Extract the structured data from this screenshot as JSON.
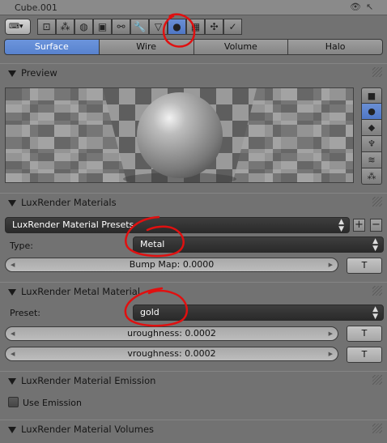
{
  "top_strip": {
    "object_name": "Cube.001"
  },
  "context_tabs": [
    {
      "icon": "render-camera-icon",
      "glyph": "📷"
    },
    {
      "icon": "render-layers-icon",
      "glyph": "◉"
    },
    {
      "icon": "world-icon",
      "glyph": "◍"
    },
    {
      "icon": "object-cube-icon",
      "glyph": "▣"
    },
    {
      "icon": "constraints-chain-icon",
      "glyph": "∞"
    },
    {
      "icon": "modifiers-wrench-icon",
      "glyph": "🔧"
    },
    {
      "icon": "data-vertices-icon",
      "glyph": "▽"
    },
    {
      "icon": "material-sphere-icon",
      "glyph": "●"
    },
    {
      "icon": "texture-checker-icon",
      "glyph": "▦"
    },
    {
      "icon": "particles-icon",
      "glyph": "✣"
    },
    {
      "icon": "physics-icon",
      "glyph": "✓"
    }
  ],
  "surface_tabs": [
    "Surface",
    "Wire",
    "Volume",
    "Halo"
  ],
  "panels": {
    "preview": "Preview",
    "materials": "LuxRender Materials",
    "metal": "LuxRender Metal Material",
    "emission": "LuxRender Material Emission",
    "volumes": "LuxRender Material Volumes"
  },
  "preview_side": [
    "flat-plane-icon",
    "sphere-icon",
    "cube-icon",
    "monkey-icon",
    "hair-icon",
    "sphere-array-icon"
  ],
  "materials": {
    "presets_label": "LuxRender Material Presets",
    "add": "+",
    "remove": "−",
    "type_label": "Type:",
    "type_value": "Metal",
    "bump_map": "Bump Map: 0.0000",
    "t_button": "T"
  },
  "metal": {
    "preset_label": "Preset:",
    "preset_value": "gold",
    "uroughness": "uroughness: 0.0002",
    "vroughness": "vroughness: 0.0002",
    "t_button": "T"
  },
  "emission": {
    "use_emission": "Use Emission"
  },
  "colors": {
    "accent_blue": "#5882ce",
    "annotation_red": "#e01010"
  }
}
